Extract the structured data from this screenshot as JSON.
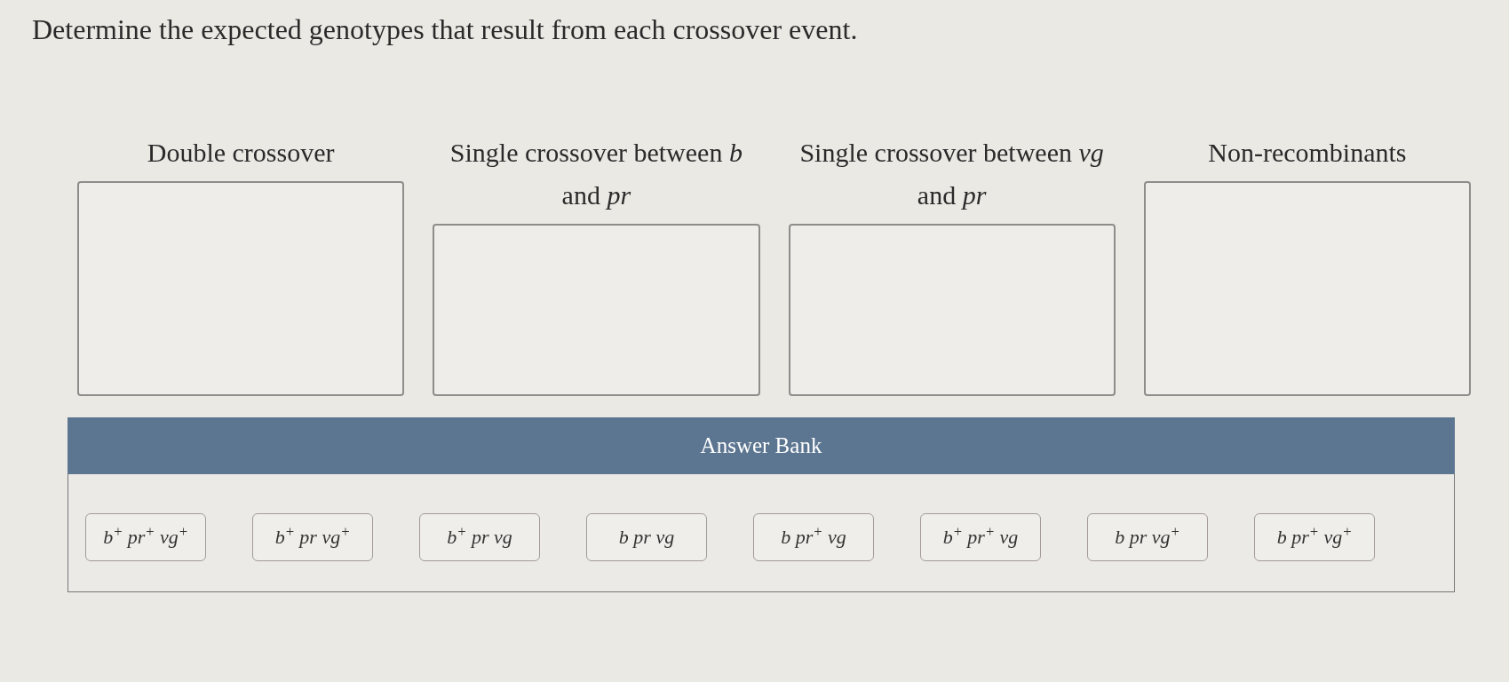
{
  "prompt": "Determine the expected genotypes that result from each crossover event.",
  "categories": [
    {
      "heading": "Double crossover"
    },
    {
      "heading": "Single crossover between *b* and *pr*"
    },
    {
      "heading": "Single crossover between *vg* and *pr*"
    },
    {
      "heading": "Non-recombinants"
    }
  ],
  "answer_bank": {
    "title": "Answer Bank",
    "items": [
      "b$^{+}$ pr$^{+}$ vg$^{+}$",
      "b$^{+}$ pr vg$^{+}$",
      "b$^{+}$ pr vg",
      "b pr vg",
      "b pr$^{+}$ vg",
      "b$^{+}$ pr$^{+}$ vg",
      "b pr vg$^{+}$",
      "b pr$^{+}$ vg$^{+}$"
    ]
  }
}
